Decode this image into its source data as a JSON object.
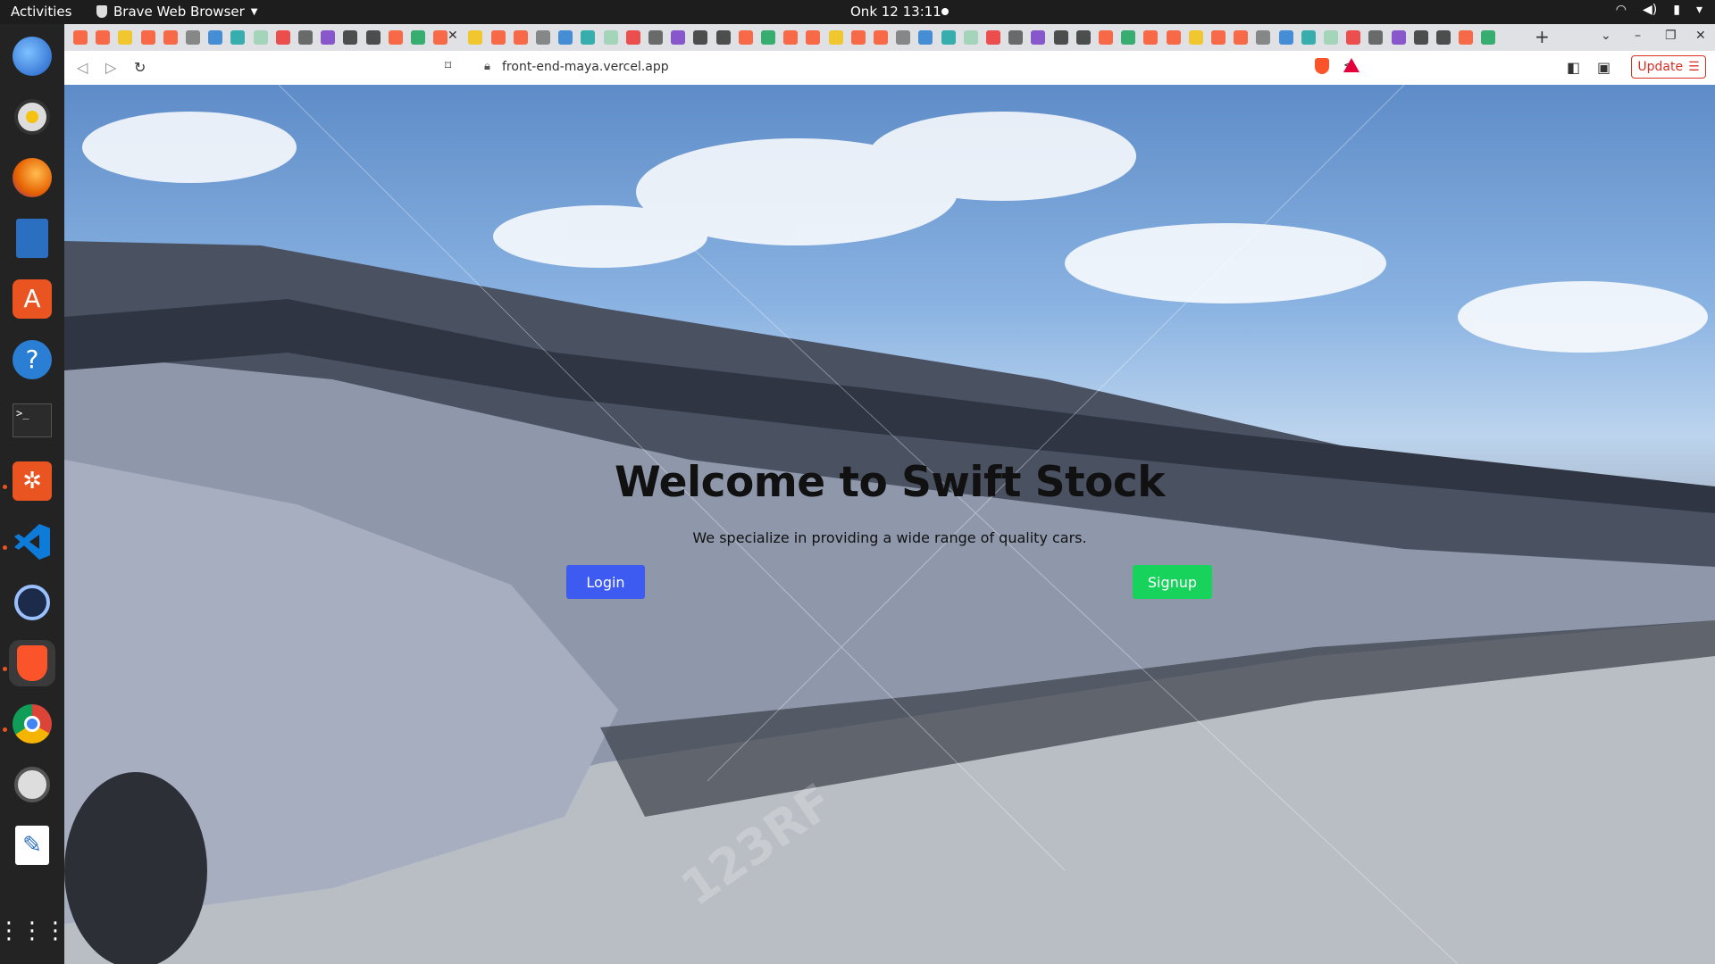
{
  "system_bar": {
    "activities": "Activities",
    "app_name": "Brave Web Browser",
    "clock": "Onk 12  13:11"
  },
  "browser": {
    "url": "front-end-maya.vercel.app",
    "update_label": "Update"
  },
  "hero": {
    "title": "Welcome to Swift Stock",
    "subtitle": "We specialize in providing a wide range of quality cars.",
    "login_label": "Login",
    "signup_label": "Signup"
  },
  "watermark": "123RF",
  "colors": {
    "login_button": "#3d5af1",
    "signup_button": "#17d35c",
    "update_button": "#d93025"
  }
}
